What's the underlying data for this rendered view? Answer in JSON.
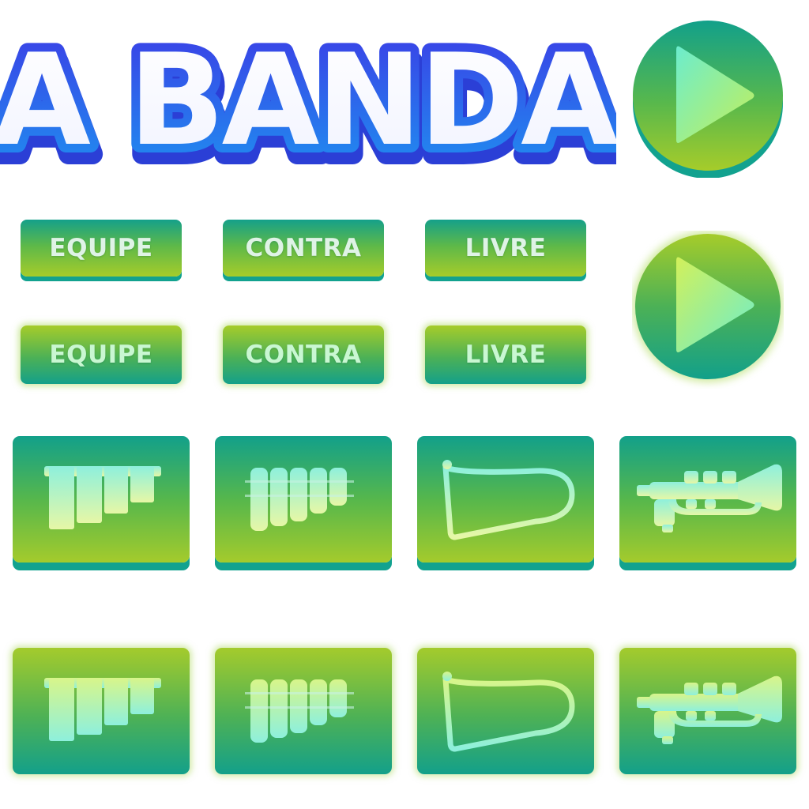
{
  "title": "A BANDA",
  "play_buttons": [
    {
      "icon": "play-icon",
      "state": "normal"
    },
    {
      "icon": "play-icon",
      "state": "highlighted"
    }
  ],
  "mode_buttons_normal": [
    {
      "label": "EQUIPE"
    },
    {
      "label": "CONTRA"
    },
    {
      "label": "LIVRE"
    }
  ],
  "mode_buttons_highlighted": [
    {
      "label": "EQUIPE"
    },
    {
      "label": "CONTRA"
    },
    {
      "label": "LIVRE"
    }
  ],
  "instruments": [
    {
      "icon": "glockenspiel-icon"
    },
    {
      "icon": "marimba-icon"
    },
    {
      "icon": "harp-icon"
    },
    {
      "icon": "trumpet-icon"
    }
  ],
  "colors": {
    "title_outline": "#2f52e6",
    "green_top": "#12a08a",
    "green_bottom": "#a4cb2c",
    "icon_light": "#c9f7d2"
  }
}
